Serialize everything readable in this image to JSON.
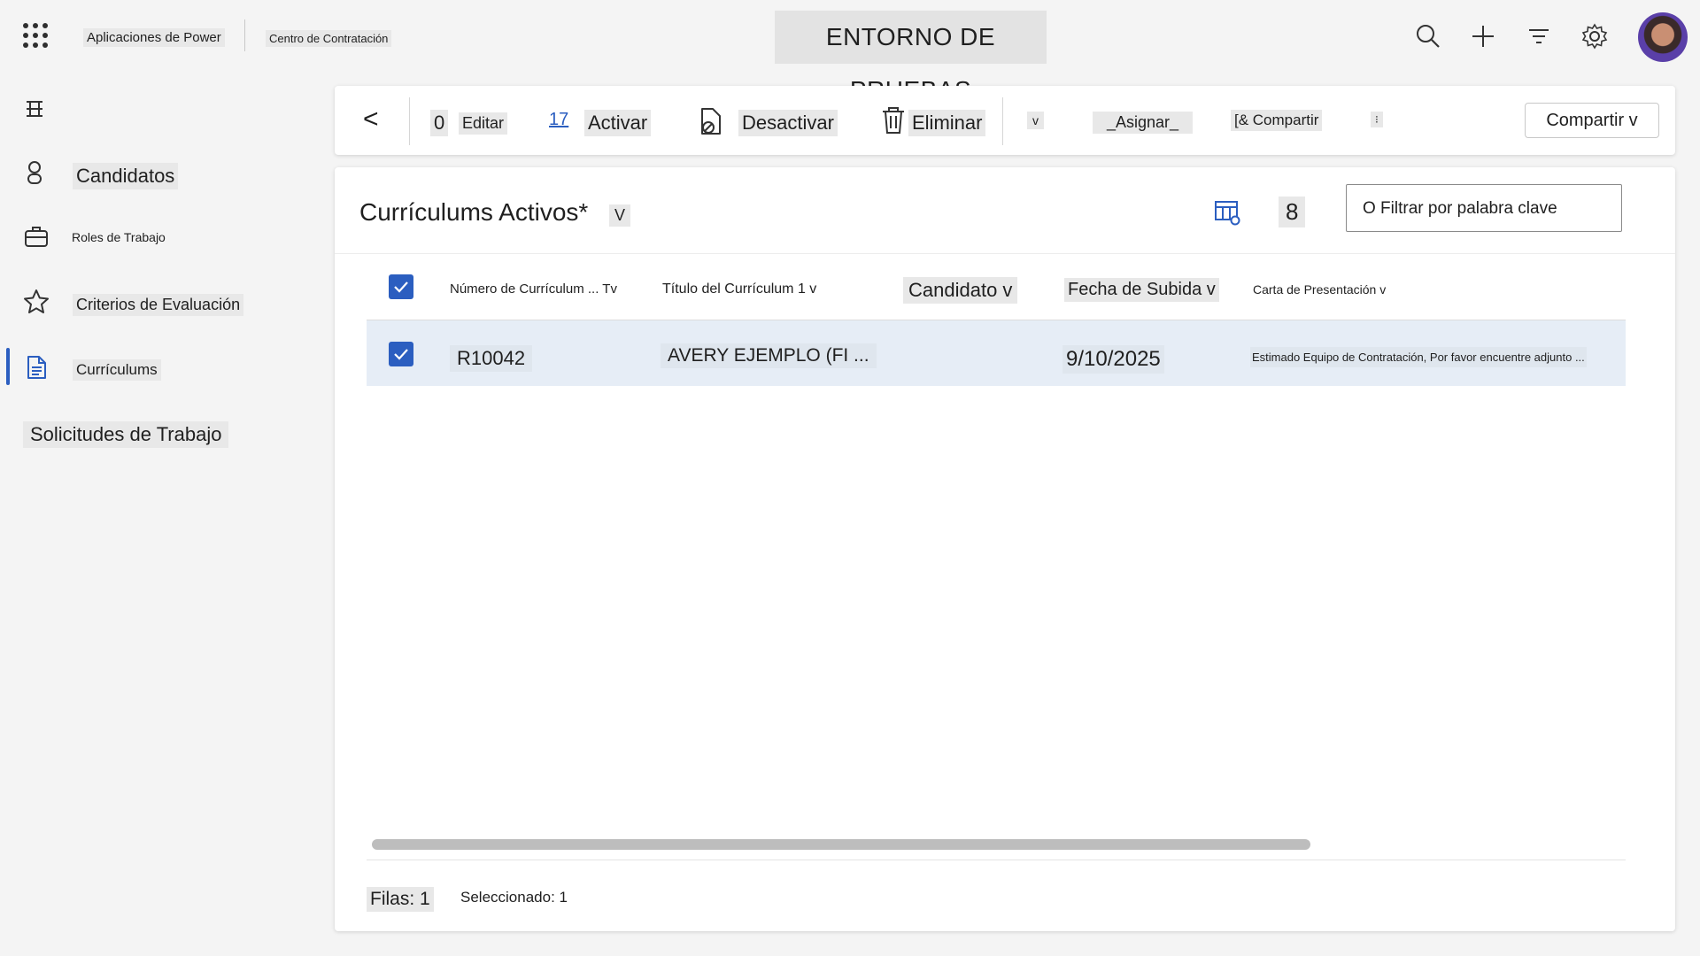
{
  "topbar": {
    "app_launcher_icon": "waffle-icon",
    "app_name": "Aplicaciones de Power",
    "app_subname": "Centro de Contratación",
    "environment": "ENTORNO DE PRUEBAS",
    "icons": [
      "search-icon",
      "plus-icon",
      "filter-icon",
      "gear-icon",
      "avatar"
    ]
  },
  "sidebar": {
    "menu_icon": "hamburger-icon",
    "items": [
      {
        "label": "Candidatos",
        "icon": "person-icon"
      },
      {
        "label": "Roles de Trabajo",
        "icon": "briefcase-icon"
      },
      {
        "label": "Criterios de Evaluación",
        "icon": "star-icon"
      },
      {
        "label": "Currículums",
        "icon": "document-icon",
        "active": true
      },
      {
        "label": "Solicitudes de Trabajo"
      }
    ]
  },
  "command_bar": {
    "back": "<",
    "edit_prefix": "0",
    "edit": "Editar",
    "activate_glyph": "17",
    "activate": "Activar",
    "deactivate": "Desactivar",
    "delete": "Eliminar",
    "more_dropdown": "v",
    "assign": "_Asignar_",
    "share_small": "[& Compartir",
    "overflow": "⁝",
    "share_button": "Compartir v"
  },
  "view": {
    "title": "Currículums Activos*",
    "title_chevron": "V",
    "count": "8",
    "filter_placeholder": "O Filtrar por palabra clave"
  },
  "table": {
    "columns": [
      "Número de Currículum ... Tv",
      "Título del Currículum 1 v",
      "Candidato v",
      "Fecha de Subida v",
      "Carta de Presentación v"
    ],
    "rows": [
      {
        "numero": "R10042",
        "titulo": "AVERY EJEMPLO (FI ...",
        "candidato": "",
        "fecha": "9/10/2025",
        "carta": "Estimado Equipo de Contratación, Por favor encuentre adjunto ..."
      }
    ]
  },
  "footer": {
    "rows": "Filas: 1",
    "selected": "Seleccionado: 1"
  },
  "colors": {
    "accent": "#2b5ec0",
    "selected_row": "#e6edf6",
    "background": "#f4f4f4"
  }
}
